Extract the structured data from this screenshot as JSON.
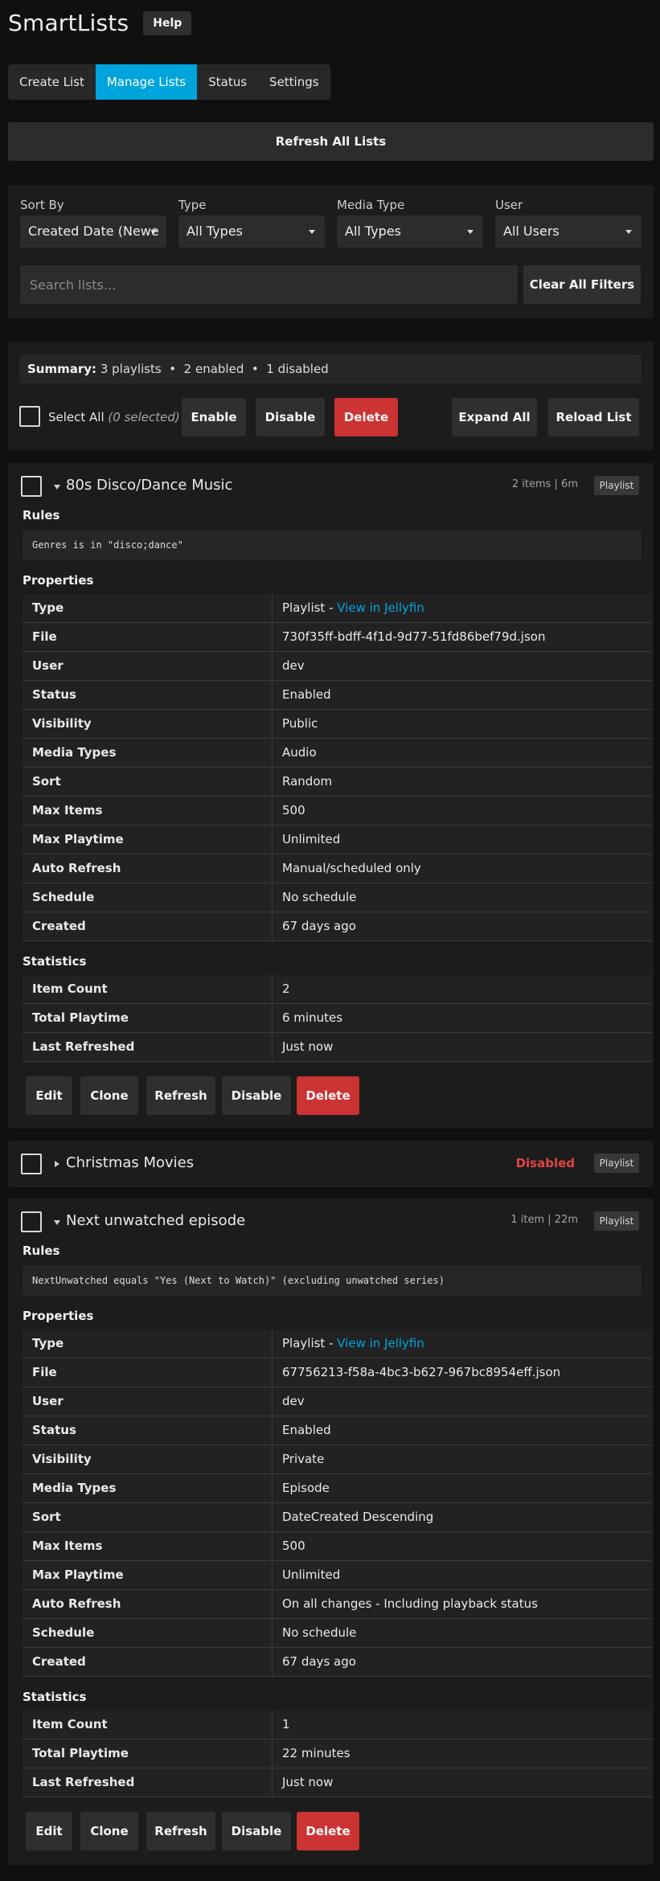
{
  "app": {
    "title": "SmartLists",
    "help_label": "Help"
  },
  "tabs": [
    {
      "label": "Create List",
      "active": false
    },
    {
      "label": "Manage Lists",
      "active": true
    },
    {
      "label": "Status",
      "active": false
    },
    {
      "label": "Settings",
      "active": false
    }
  ],
  "refresh_all_label": "Refresh All Lists",
  "filters": {
    "sort_by": {
      "label": "Sort By",
      "value": "Created Date (Newe"
    },
    "type": {
      "label": "Type",
      "value": "All Types"
    },
    "media_type": {
      "label": "Media Type",
      "value": "All Types"
    },
    "user": {
      "label": "User",
      "value": "All Users"
    },
    "search_placeholder": "Search lists...",
    "clear_label": "Clear All Filters"
  },
  "summary": {
    "label": "Summary:",
    "text": "3 playlists  •  2 enabled  •  1 disabled",
    "select_all_label": "Select All",
    "selected_count": "(0 selected)",
    "enable_label": "Enable",
    "disable_label": "Disable",
    "delete_label": "Delete",
    "expand_all_label": "Expand All",
    "reload_label": "Reload List"
  },
  "headings": {
    "rules": "Rules",
    "properties": "Properties",
    "statistics": "Statistics"
  },
  "actions": {
    "edit": "Edit",
    "clone": "Clone",
    "refresh": "Refresh",
    "disable": "Disable",
    "delete": "Delete"
  },
  "lists": [
    {
      "title": "80s Disco/Dance Music",
      "meta": "2 items | 6m",
      "badge": "Playlist",
      "expanded": true,
      "rule": "Genres is in \"disco;dance\"",
      "properties": [
        {
          "key": "Type",
          "value": "Playlist - ",
          "link": "View in Jellyfin"
        },
        {
          "key": "File",
          "value": "730f35ff-bdff-4f1d-9d77-51fd86bef79d.json"
        },
        {
          "key": "User",
          "value": "dev"
        },
        {
          "key": "Status",
          "value": "Enabled"
        },
        {
          "key": "Visibility",
          "value": "Public"
        },
        {
          "key": "Media Types",
          "value": "Audio"
        },
        {
          "key": "Sort",
          "value": "Random"
        },
        {
          "key": "Max Items",
          "value": "500"
        },
        {
          "key": "Max Playtime",
          "value": "Unlimited"
        },
        {
          "key": "Auto Refresh",
          "value": "Manual/scheduled only"
        },
        {
          "key": "Schedule",
          "value": "No schedule"
        },
        {
          "key": "Created",
          "value": "67 days ago"
        }
      ],
      "statistics": [
        {
          "key": "Item Count",
          "value": "2"
        },
        {
          "key": "Total Playtime",
          "value": "6 minutes"
        },
        {
          "key": "Last Refreshed",
          "value": "Just now"
        }
      ]
    },
    {
      "title": "Christmas Movies",
      "status": "Disabled",
      "badge": "Playlist",
      "expanded": false
    },
    {
      "title": "Next unwatched episode",
      "meta": "1 item | 22m",
      "badge": "Playlist",
      "expanded": true,
      "rule": "NextUnwatched equals \"Yes (Next to Watch)\" (excluding unwatched series)",
      "properties": [
        {
          "key": "Type",
          "value": "Playlist - ",
          "link": "View in Jellyfin"
        },
        {
          "key": "File",
          "value": "67756213-f58a-4bc3-b627-967bc8954eff.json"
        },
        {
          "key": "User",
          "value": "dev"
        },
        {
          "key": "Status",
          "value": "Enabled"
        },
        {
          "key": "Visibility",
          "value": "Private"
        },
        {
          "key": "Media Types",
          "value": "Episode"
        },
        {
          "key": "Sort",
          "value": "DateCreated Descending"
        },
        {
          "key": "Max Items",
          "value": "500"
        },
        {
          "key": "Max Playtime",
          "value": "Unlimited"
        },
        {
          "key": "Auto Refresh",
          "value": "On all changes - Including playback status"
        },
        {
          "key": "Schedule",
          "value": "No schedule"
        },
        {
          "key": "Created",
          "value": "67 days ago"
        }
      ],
      "statistics": [
        {
          "key": "Item Count",
          "value": "1"
        },
        {
          "key": "Total Playtime",
          "value": "22 minutes"
        },
        {
          "key": "Last Refreshed",
          "value": "Just now"
        }
      ]
    }
  ]
}
